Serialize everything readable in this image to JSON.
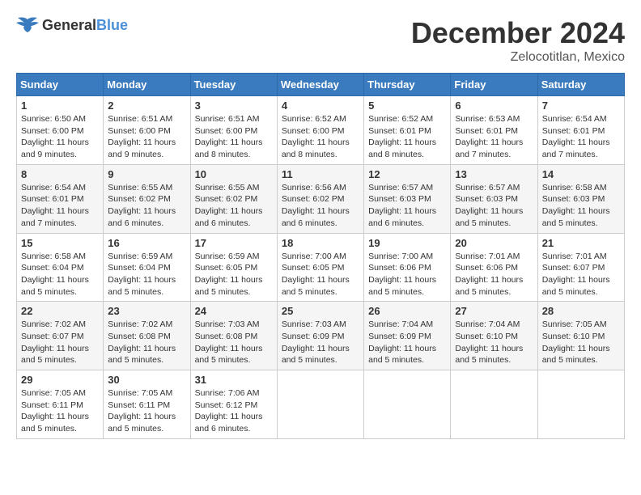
{
  "header": {
    "logo": {
      "general": "General",
      "blue": "Blue"
    },
    "title": "December 2024",
    "location": "Zelocotitlan, Mexico"
  },
  "weekdays": [
    "Sunday",
    "Monday",
    "Tuesday",
    "Wednesday",
    "Thursday",
    "Friday",
    "Saturday"
  ],
  "weeks": [
    [
      {
        "day": "1",
        "info": "Sunrise: 6:50 AM\nSunset: 6:00 PM\nDaylight: 11 hours\nand 9 minutes."
      },
      {
        "day": "2",
        "info": "Sunrise: 6:51 AM\nSunset: 6:00 PM\nDaylight: 11 hours\nand 9 minutes."
      },
      {
        "day": "3",
        "info": "Sunrise: 6:51 AM\nSunset: 6:00 PM\nDaylight: 11 hours\nand 8 minutes."
      },
      {
        "day": "4",
        "info": "Sunrise: 6:52 AM\nSunset: 6:00 PM\nDaylight: 11 hours\nand 8 minutes."
      },
      {
        "day": "5",
        "info": "Sunrise: 6:52 AM\nSunset: 6:01 PM\nDaylight: 11 hours\nand 8 minutes."
      },
      {
        "day": "6",
        "info": "Sunrise: 6:53 AM\nSunset: 6:01 PM\nDaylight: 11 hours\nand 7 minutes."
      },
      {
        "day": "7",
        "info": "Sunrise: 6:54 AM\nSunset: 6:01 PM\nDaylight: 11 hours\nand 7 minutes."
      }
    ],
    [
      {
        "day": "8",
        "info": "Sunrise: 6:54 AM\nSunset: 6:01 PM\nDaylight: 11 hours\nand 7 minutes."
      },
      {
        "day": "9",
        "info": "Sunrise: 6:55 AM\nSunset: 6:02 PM\nDaylight: 11 hours\nand 6 minutes."
      },
      {
        "day": "10",
        "info": "Sunrise: 6:55 AM\nSunset: 6:02 PM\nDaylight: 11 hours\nand 6 minutes."
      },
      {
        "day": "11",
        "info": "Sunrise: 6:56 AM\nSunset: 6:02 PM\nDaylight: 11 hours\nand 6 minutes."
      },
      {
        "day": "12",
        "info": "Sunrise: 6:57 AM\nSunset: 6:03 PM\nDaylight: 11 hours\nand 6 minutes."
      },
      {
        "day": "13",
        "info": "Sunrise: 6:57 AM\nSunset: 6:03 PM\nDaylight: 11 hours\nand 5 minutes."
      },
      {
        "day": "14",
        "info": "Sunrise: 6:58 AM\nSunset: 6:03 PM\nDaylight: 11 hours\nand 5 minutes."
      }
    ],
    [
      {
        "day": "15",
        "info": "Sunrise: 6:58 AM\nSunset: 6:04 PM\nDaylight: 11 hours\nand 5 minutes."
      },
      {
        "day": "16",
        "info": "Sunrise: 6:59 AM\nSunset: 6:04 PM\nDaylight: 11 hours\nand 5 minutes."
      },
      {
        "day": "17",
        "info": "Sunrise: 6:59 AM\nSunset: 6:05 PM\nDaylight: 11 hours\nand 5 minutes."
      },
      {
        "day": "18",
        "info": "Sunrise: 7:00 AM\nSunset: 6:05 PM\nDaylight: 11 hours\nand 5 minutes."
      },
      {
        "day": "19",
        "info": "Sunrise: 7:00 AM\nSunset: 6:06 PM\nDaylight: 11 hours\nand 5 minutes."
      },
      {
        "day": "20",
        "info": "Sunrise: 7:01 AM\nSunset: 6:06 PM\nDaylight: 11 hours\nand 5 minutes."
      },
      {
        "day": "21",
        "info": "Sunrise: 7:01 AM\nSunset: 6:07 PM\nDaylight: 11 hours\nand 5 minutes."
      }
    ],
    [
      {
        "day": "22",
        "info": "Sunrise: 7:02 AM\nSunset: 6:07 PM\nDaylight: 11 hours\nand 5 minutes."
      },
      {
        "day": "23",
        "info": "Sunrise: 7:02 AM\nSunset: 6:08 PM\nDaylight: 11 hours\nand 5 minutes."
      },
      {
        "day": "24",
        "info": "Sunrise: 7:03 AM\nSunset: 6:08 PM\nDaylight: 11 hours\nand 5 minutes."
      },
      {
        "day": "25",
        "info": "Sunrise: 7:03 AM\nSunset: 6:09 PM\nDaylight: 11 hours\nand 5 minutes."
      },
      {
        "day": "26",
        "info": "Sunrise: 7:04 AM\nSunset: 6:09 PM\nDaylight: 11 hours\nand 5 minutes."
      },
      {
        "day": "27",
        "info": "Sunrise: 7:04 AM\nSunset: 6:10 PM\nDaylight: 11 hours\nand 5 minutes."
      },
      {
        "day": "28",
        "info": "Sunrise: 7:05 AM\nSunset: 6:10 PM\nDaylight: 11 hours\nand 5 minutes."
      }
    ],
    [
      {
        "day": "29",
        "info": "Sunrise: 7:05 AM\nSunset: 6:11 PM\nDaylight: 11 hours\nand 5 minutes."
      },
      {
        "day": "30",
        "info": "Sunrise: 7:05 AM\nSunset: 6:11 PM\nDaylight: 11 hours\nand 5 minutes."
      },
      {
        "day": "31",
        "info": "Sunrise: 7:06 AM\nSunset: 6:12 PM\nDaylight: 11 hours\nand 6 minutes."
      },
      null,
      null,
      null,
      null
    ]
  ]
}
